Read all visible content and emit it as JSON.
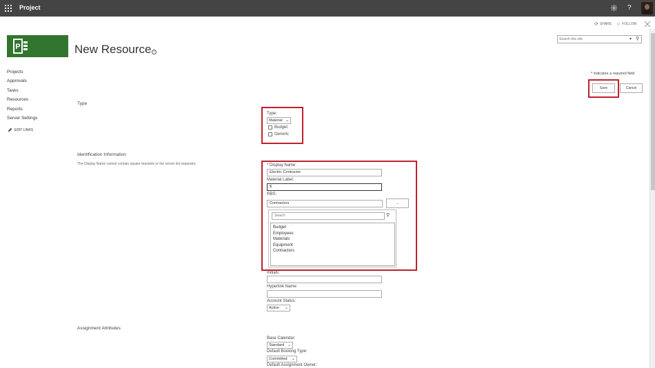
{
  "suitebar": {
    "app_title": "Project",
    "bg_color": "#444444",
    "icons": [
      "waffle-icon",
      "gear-icon",
      "help-icon",
      "avatar"
    ]
  },
  "actions": {
    "share": "SHARE",
    "follow": "FOLLOW"
  },
  "search": {
    "placeholder": "Search this site"
  },
  "page": {
    "title": "New Resource",
    "required_note": "indicates a required field"
  },
  "nav": {
    "items": [
      "Projects",
      "Approvals",
      "Tasks",
      "Resources",
      "Reports",
      "Server Settings"
    ],
    "edit_links": "EDIT LINKS"
  },
  "buttons": {
    "save": "Save",
    "cancel": "Cancel"
  },
  "sections": {
    "type": {
      "title": "Type",
      "type_label": "Type:",
      "type_value": "Material",
      "budget_label": "Budget",
      "budget_checked": false,
      "generic_label": "Generic",
      "generic_checked": false
    },
    "identification": {
      "title": "Identification Information",
      "description": "The Display Name cannot contain square brackets or the server list separator.",
      "display_name_label": "Display Name:",
      "display_name_value": "Electric Contractor",
      "material_label_label": "Material Label:",
      "material_label_value": "$",
      "rbs_label": "RBS:",
      "rbs_value": "Contractors",
      "rbs_button": "...",
      "picker_search_placeholder": "Search",
      "picker_options": [
        "Budget",
        "Employees",
        "Materials",
        "Equipment",
        "Contractors"
      ],
      "initials_label": "Initials:",
      "initials_value": "",
      "hyperlink_label": "Hyperlink Name:",
      "hyperlink_value": "",
      "account_status_label": "Account Status:",
      "account_status_value": "Active"
    },
    "assignment": {
      "title": "Assignment Attributes",
      "base_calendar_label": "Base Calendar:",
      "base_calendar_value": "Standard",
      "booking_type_label": "Default Booking Type:",
      "booking_type_value": "Committed",
      "assignment_owner_label": "Default Assignment Owner:"
    }
  },
  "colors": {
    "highlight": "#c0202d",
    "logo_green": "#31752f"
  }
}
